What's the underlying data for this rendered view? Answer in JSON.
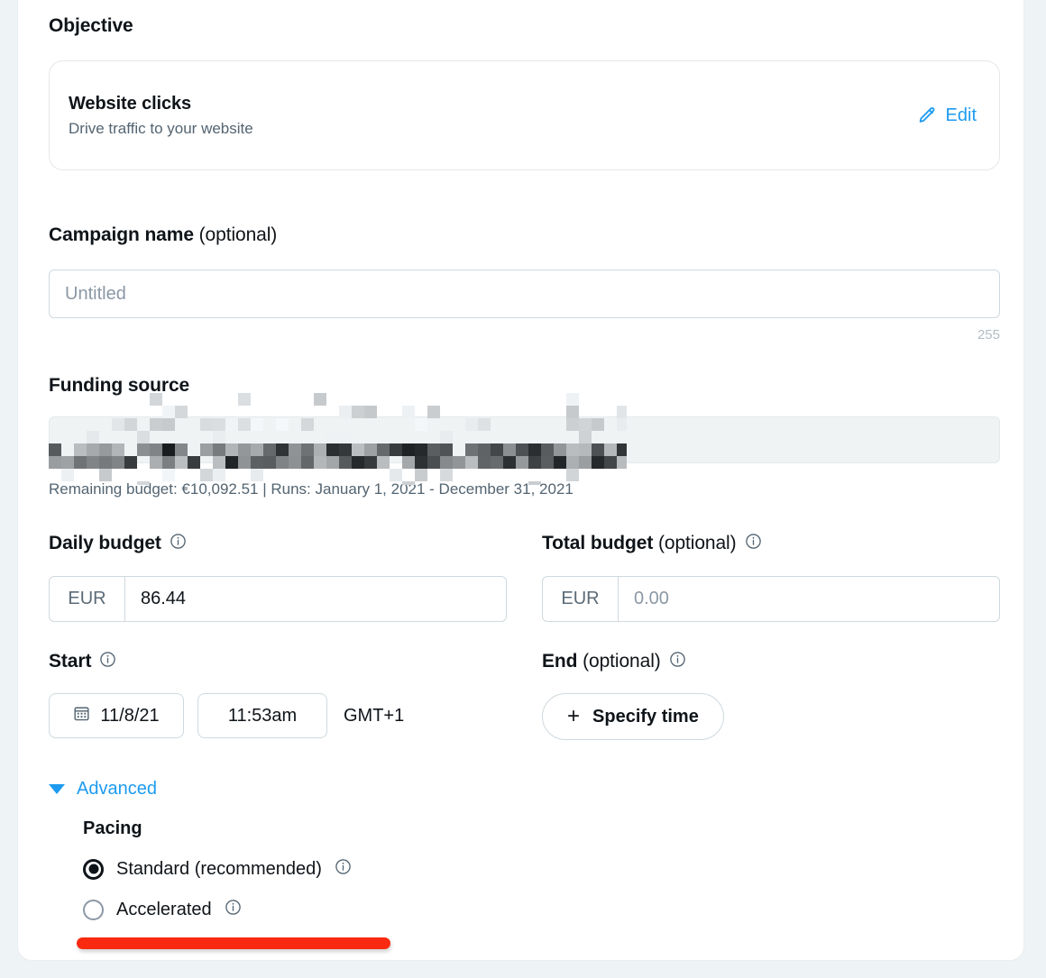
{
  "objective": {
    "section_label": "Objective",
    "title": "Website clicks",
    "subtitle": "Drive traffic to your website",
    "edit_label": "Edit",
    "edit_icon": "pencil-icon"
  },
  "campaign_name": {
    "label": "Campaign name",
    "optional_suffix": " (optional)",
    "value": "",
    "placeholder": "Untitled",
    "char_counter": "255"
  },
  "funding_source": {
    "label": "Funding source",
    "value_redacted": true,
    "note": "Remaining budget: €10,092.51 | Runs: January 1, 2021 - December 31, 2021"
  },
  "daily_budget": {
    "label": "Daily budget",
    "optional_suffix": "",
    "info_icon": "info-icon",
    "currency": "EUR",
    "value": "86.44",
    "placeholder": "0.00"
  },
  "total_budget": {
    "label": "Total budget",
    "optional_suffix": " (optional)",
    "info_icon": "info-icon",
    "currency": "EUR",
    "value": "",
    "placeholder": "0.00"
  },
  "start": {
    "label": "Start",
    "optional_suffix": "",
    "info_icon": "info-icon",
    "calendar_icon": "calendar-icon",
    "date": "11/8/21",
    "time": "11:53am",
    "timezone": "GMT+1"
  },
  "end": {
    "label": "End",
    "optional_suffix": " (optional)",
    "info_icon": "info-icon",
    "specify_time_label": "Specify time",
    "plus_glyph": "+"
  },
  "advanced": {
    "label": "Advanced",
    "expanded": true,
    "caret_icon": "chevron-down-icon",
    "pacing": {
      "title": "Pacing",
      "options": [
        {
          "label": "Standard (recommended)",
          "selected": true,
          "info_icon": "info-icon"
        },
        {
          "label": "Accelerated",
          "selected": false,
          "info_icon": "info-icon"
        }
      ]
    }
  },
  "annotation": {
    "type": "red-underline",
    "color": "#f92a10"
  },
  "colors": {
    "accent_blue": "#1d9bf0",
    "text_primary": "#0f1419",
    "text_secondary": "#536471",
    "border": "#cfd9de",
    "disabled_bg": "#eff3f4",
    "page_bg": "#eef3f5",
    "annotation_red": "#f92a10"
  }
}
